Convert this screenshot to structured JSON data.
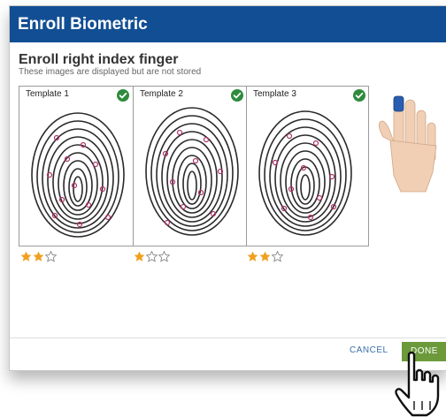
{
  "dialog": {
    "title": "Enroll Biometric",
    "heading": "Enroll right index finger",
    "subheading": "These images are displayed but are not stored"
  },
  "templates": [
    {
      "label": "Template 1",
      "rating": 2,
      "max_rating": 3,
      "status_icon": "check-circle-icon"
    },
    {
      "label": "Template 2",
      "rating": 1,
      "max_rating": 3,
      "status_icon": "check-circle-icon"
    },
    {
      "label": "Template 3",
      "rating": 2,
      "max_rating": 3,
      "status_icon": "check-circle-icon"
    }
  ],
  "hand_illustration": {
    "icon": "hand-icon",
    "highlighted_finger": "index"
  },
  "footer": {
    "cancel_label": "CANCEL",
    "done_label": "DONE"
  },
  "colors": {
    "title_bar": "#124e93",
    "check": "#2e8b3d",
    "star": "#f0a020",
    "done_button": "#6c9a3b",
    "finger_highlight": "#2a5db0"
  }
}
